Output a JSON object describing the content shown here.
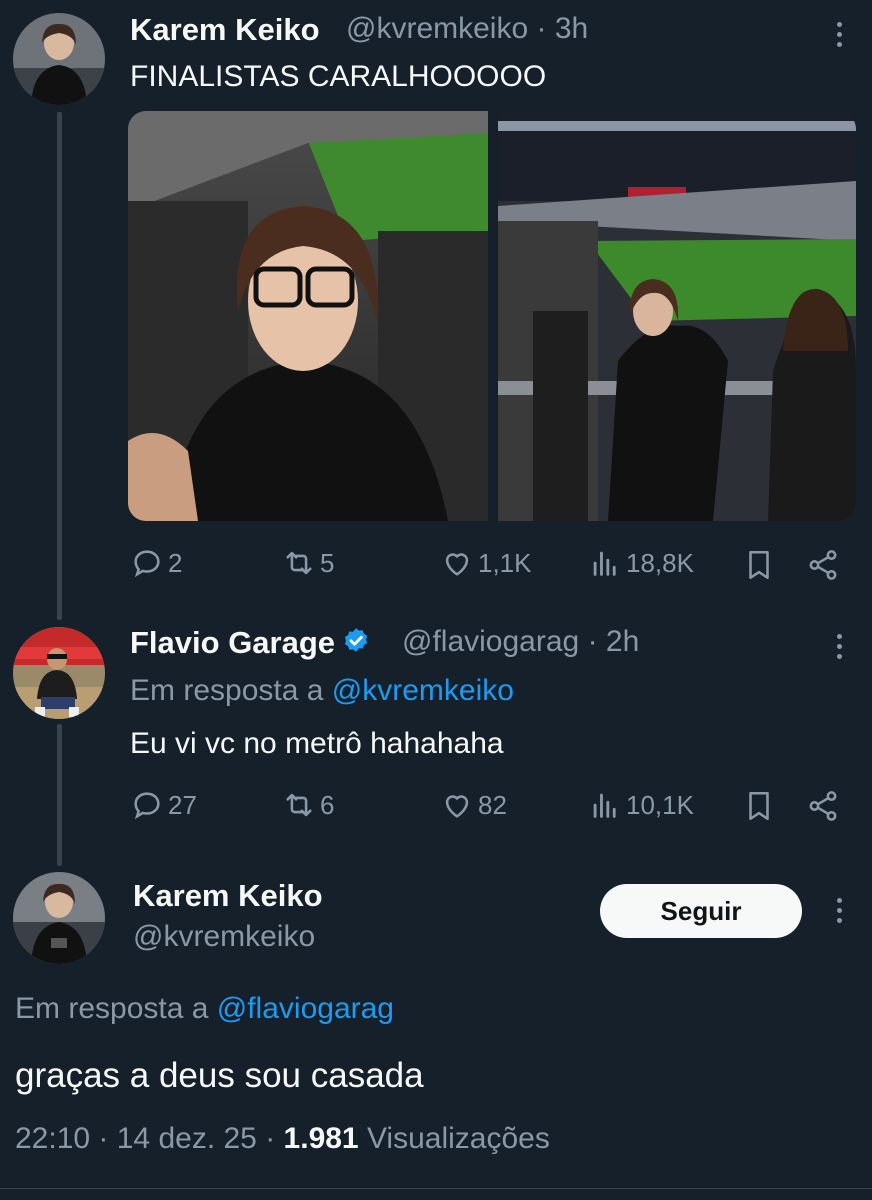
{
  "tweet1": {
    "name": "Karem Keiko",
    "handle": "@kvremkeiko",
    "time": "· 3h",
    "text": "FINALISTAS CARALHOOOOO",
    "stats": {
      "replies": "2",
      "reposts": "5",
      "likes": "1,1K",
      "views": "18,8K"
    }
  },
  "tweet2": {
    "name": "Flavio Garage",
    "handle": "@flaviogarag",
    "time": "· 2h",
    "reply_prefix": "Em resposta a",
    "reply_to": "@kvremkeiko",
    "text": "Eu vi vc no metrô hahahaha",
    "stats": {
      "replies": "27",
      "reposts": "6",
      "likes": "82",
      "views": "10,1K"
    }
  },
  "main_tweet": {
    "name": "Karem Keiko",
    "handle": "@kvremkeiko",
    "follow_label": "Seguir",
    "reply_prefix": "Em resposta a",
    "reply_to": "@flaviogarag",
    "text": "graças a deus sou casada",
    "time": "22:10",
    "date": "14 dez. 25",
    "views_count": "1.981",
    "views_label": "Visualizações"
  },
  "colors": {
    "background": "#15202b",
    "text": "#f7f9f9",
    "muted": "#8b98a5",
    "link": "#1d9bf0",
    "thread_line": "#38444d"
  },
  "icons": [
    "reply-icon",
    "repost-icon",
    "like-icon",
    "views-icon",
    "bookmark-icon",
    "share-icon",
    "more-icon",
    "verified-icon"
  ]
}
